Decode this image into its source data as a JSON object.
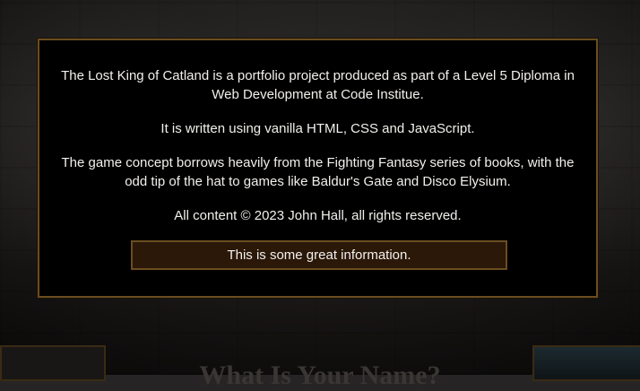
{
  "info": {
    "paragraphs": [
      "The Lost King of Catland is a portfolio project produced as part of a Level 5 Diploma in Web Development at Code Institue.",
      "It is written using vanilla HTML, CSS and JavaScript.",
      "The game concept borrows heavily from the Fighting Fantasy series of books, with the odd tip of the hat to games like Baldur's Gate and Disco Elysium.",
      "All content © 2023 John Hall, all rights reserved."
    ],
    "button_label": "This is some great information."
  },
  "background": {
    "heading": "What Is Your Name?"
  },
  "colors": {
    "panel_background": "#000000",
    "panel_border": "#6b4d20",
    "button_background": "#2b1809",
    "text": "#f2f0ec"
  }
}
